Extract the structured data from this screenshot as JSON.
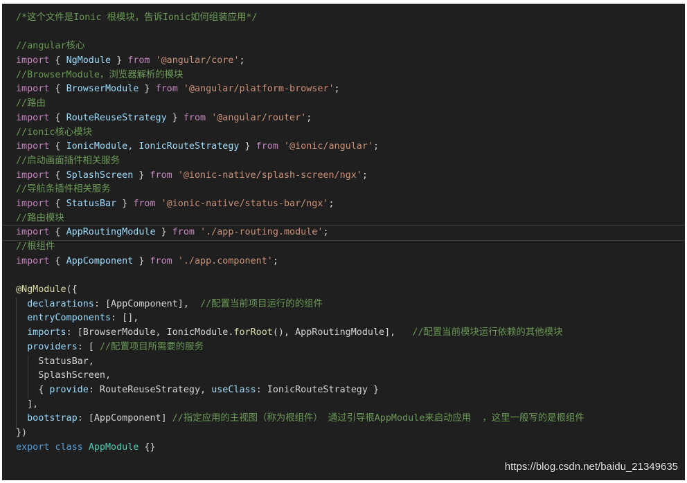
{
  "comment_file": "/*这个文件是Ionic 根模块，告诉Ionic如何组装应用*/",
  "comment_angular": "//angular核心",
  "comment_browser": "//BrowserModule，浏览器解析的模块",
  "comment_route": "//路由",
  "comment_ionic": "//ionic核心模块",
  "comment_splash": "//启动画面插件相关服务",
  "comment_statusbar": "//导航条插件相关服务",
  "comment_routing": "//路由模块",
  "comment_root": "//根组件",
  "imports": [
    {
      "kw": "import",
      "open": " { ",
      "names": "NgModule",
      "close": " } ",
      "from": "from",
      "path": "'@angular/core'",
      "end": ";"
    },
    {
      "kw": "import",
      "open": " { ",
      "names": "BrowserModule",
      "close": " } ",
      "from": "from",
      "path": "'@angular/platform-browser'",
      "end": ";"
    },
    {
      "kw": "import",
      "open": " { ",
      "names": "RouteReuseStrategy",
      "close": " } ",
      "from": "from",
      "path": "'@angular/router'",
      "end": ";"
    },
    {
      "kw": "import",
      "open": " { ",
      "names": "IonicModule, IonicRouteStrategy",
      "close": " } ",
      "from": "from",
      "path": "'@ionic/angular'",
      "end": ";"
    },
    {
      "kw": "import",
      "open": " { ",
      "names": "SplashScreen",
      "close": " } ",
      "from": "from",
      "path": "'@ionic-native/splash-screen/ngx'",
      "end": ";"
    },
    {
      "kw": "import",
      "open": " { ",
      "names": "StatusBar",
      "close": " } ",
      "from": "from",
      "path": "'@ionic-native/status-bar/ngx'",
      "end": ";"
    },
    {
      "kw": "import",
      "open": " { ",
      "names": "AppRoutingModule",
      "close": " } ",
      "from": "from",
      "path": "'./app-routing.module'",
      "end": ";"
    },
    {
      "kw": "import",
      "open": " { ",
      "names": "AppComponent",
      "close": " } ",
      "from": "from",
      "path": "'./app.component'",
      "end": ";"
    }
  ],
  "decorator": "@NgModule",
  "decorator_open": "({",
  "declarations_key": "declarations",
  "declarations_val": ": [AppComponent],  ",
  "declarations_cmt": "//配置当前项目运行的的组件",
  "entry_key": "entryComponents",
  "entry_val": ": [],",
  "imports_key": "imports",
  "imports_val_1": ": [BrowserModule, IonicModule.",
  "imports_fn": "forRoot",
  "imports_val_2": "(), AppRoutingModule],   ",
  "imports_cmt": "//配置当前模块运行依赖的其他模块",
  "providers_key": "providers",
  "providers_val": ": [ ",
  "providers_cmt": "//配置项目所需要的服务",
  "prov_statusbar": "StatusBar,",
  "prov_splash": "SplashScreen,",
  "prov_open": "{ ",
  "prov_provide_key": "provide",
  "prov_provide_val": ": RouteReuseStrategy, ",
  "prov_useclass_key": "useClass",
  "prov_useclass_val": ": IonicRouteStrategy }",
  "providers_close": "],",
  "bootstrap_key": "bootstrap",
  "bootstrap_val": ": [AppComponent] ",
  "bootstrap_cmt": "//指定应用的主视图（称为根组件） 通过引导根AppModule来启动应用  ，这里一般写的是根组件",
  "decorator_close": "})",
  "export_kw": "export",
  "class_kw": "class",
  "class_name": "AppModule",
  "class_body": " {}",
  "watermark": "https://blog.csdn.net/baidu_21349635"
}
